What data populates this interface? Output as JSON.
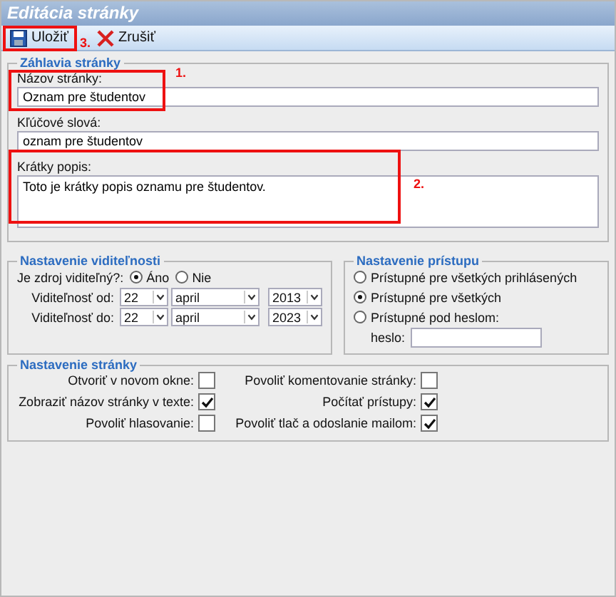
{
  "window": {
    "title": "Editácia stránky"
  },
  "toolbar": [
    {
      "kind": "save",
      "label": "Uložiť"
    },
    {
      "kind": "cancel",
      "label": "Zrušiť"
    }
  ],
  "header_section": {
    "title": "Záhlavia stránky",
    "fields": [
      {
        "kind": "input",
        "label": "Názov stránky:",
        "value": "Oznam pre študentov"
      },
      {
        "kind": "input",
        "label": "Kľúčové slová:",
        "value": "oznam pre študentov"
      },
      {
        "kind": "textarea",
        "label": "Krátky popis:",
        "value": "Toto je krátky popis oznamu pre študentov."
      }
    ]
  },
  "visibility": {
    "title": "Nastavenie viditeľnosti",
    "question": "Je zdroj viditeľný?:",
    "options": [
      {
        "label": "Áno",
        "selected": true
      },
      {
        "label": "Nie",
        "selected": false
      }
    ],
    "dates": [
      {
        "label": "Viditeľnosť od:",
        "day": "22",
        "month": "april",
        "year": "2013"
      },
      {
        "label": "Viditeľnosť do:",
        "day": "22",
        "month": "april",
        "year": "2023"
      }
    ]
  },
  "access": {
    "title": "Nastavenie prístupu",
    "options": [
      {
        "label": "Prístupné pre všetkých prihlásených",
        "selected": false
      },
      {
        "label": "Prístupné pre všetkých",
        "selected": true
      },
      {
        "label": "Prístupné pod heslom:",
        "selected": false
      }
    ],
    "password_label": "heslo:"
  },
  "page_settings": {
    "title": "Nastavenie stránky",
    "options": [
      {
        "label": "Otvoriť v novom okne:",
        "checked": false
      },
      {
        "label": "Povoliť komentovanie stránky:",
        "checked": false
      },
      {
        "label": "Zobraziť názov stránky v texte:",
        "checked": true
      },
      {
        "label": "Počítať prístupy:",
        "checked": true
      },
      {
        "label": "Povoliť hlasovanie:",
        "checked": false
      },
      {
        "label": "Povoliť tlač a odoslanie mailom:",
        "checked": true
      }
    ]
  },
  "annotations": [
    {
      "label": "1."
    },
    {
      "label": "2."
    },
    {
      "label": "3."
    }
  ]
}
